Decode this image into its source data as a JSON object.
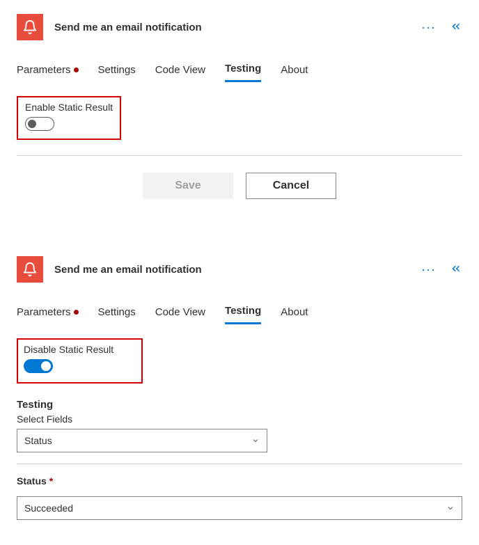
{
  "panel1": {
    "title": "Send me an email notification",
    "tabs": [
      {
        "label": "Parameters",
        "hasDot": true
      },
      {
        "label": "Settings"
      },
      {
        "label": "Code View"
      },
      {
        "label": "Testing",
        "active": true
      },
      {
        "label": "About"
      }
    ],
    "toggleLabel": "Enable Static Result",
    "toggleState": "off",
    "buttons": {
      "save": "Save",
      "cancel": "Cancel"
    }
  },
  "panel2": {
    "title": "Send me an email notification",
    "tabs": [
      {
        "label": "Parameters",
        "hasDot": true
      },
      {
        "label": "Settings"
      },
      {
        "label": "Code View"
      },
      {
        "label": "Testing",
        "active": true
      },
      {
        "label": "About"
      }
    ],
    "toggleLabel": "Disable Static Result",
    "toggleState": "on",
    "testing": {
      "heading": "Testing",
      "selectFieldsLabel": "Select Fields",
      "selectFieldsValue": "Status",
      "statusLabel": "Status",
      "statusValue": "Succeeded"
    }
  }
}
